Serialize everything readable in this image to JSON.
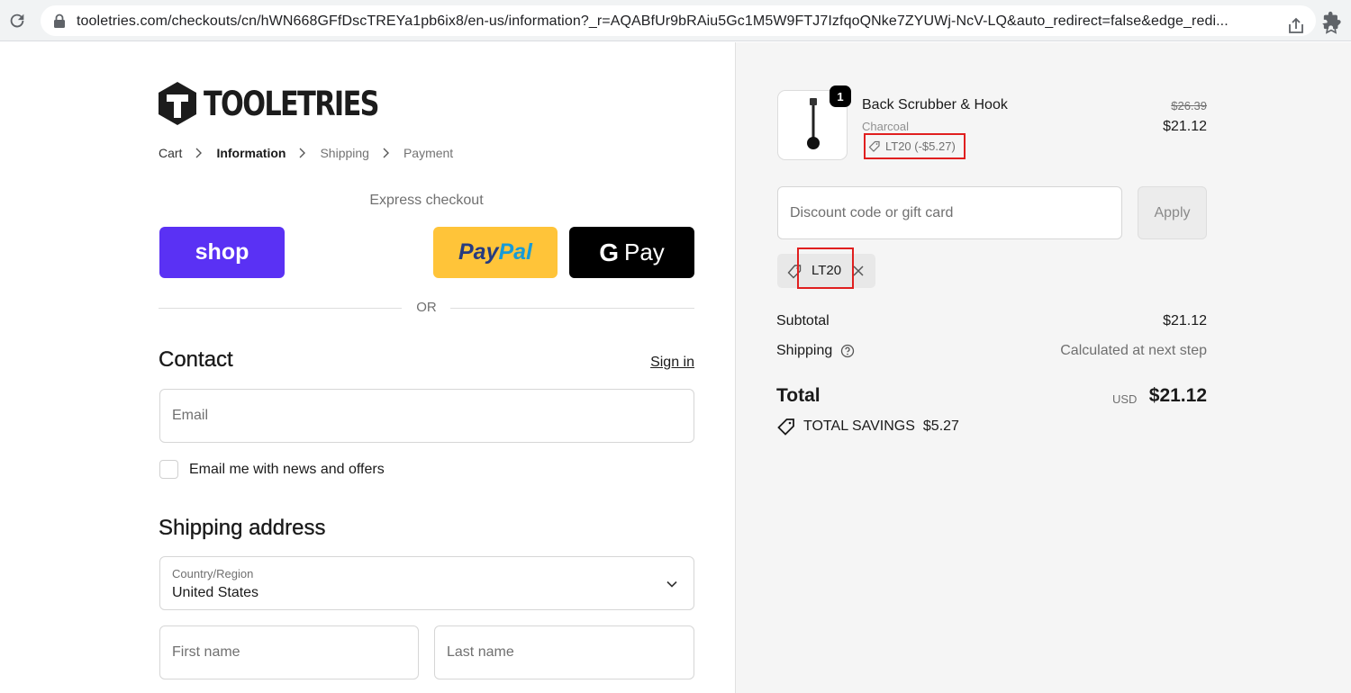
{
  "browser": {
    "url": "tooletries.com/checkouts/cn/hWN668GFfDscTREYa1pb6ix8/en-us/information?_r=AQABfUr9bRAiu5Gc1M5W9FTJ7IzfqoQNke7ZYUWj-NcV-LQ&auto_redirect=false&edge_redi..."
  },
  "brand": {
    "name": "TOOLETRIES"
  },
  "breadcrumb": {
    "cart": "Cart",
    "information": "Information",
    "shipping": "Shipping",
    "payment": "Payment"
  },
  "express": {
    "label": "Express checkout",
    "shop": "shop",
    "paypal_1": "Pay",
    "paypal_2": "Pal",
    "gpay_g": "G",
    "gpay": "Pay",
    "or": "OR"
  },
  "contact": {
    "heading": "Contact",
    "sign_in": "Sign in",
    "email_placeholder": "Email",
    "newsletter_label": "Email me with news and offers"
  },
  "shipping_address": {
    "heading": "Shipping address",
    "country_label": "Country/Region",
    "country_value": "United States",
    "first_name_placeholder": "First name",
    "last_name_placeholder": "Last name"
  },
  "order": {
    "quantity": "1",
    "product_name": "Back Scrubber & Hook",
    "variant": "Charcoal",
    "discount_tag": "LT20 (-$5.27)",
    "price_original": "$26.39",
    "price_current": "$21.12",
    "discount_placeholder": "Discount code or gift card",
    "apply_label": "Apply",
    "applied_code": "LT20",
    "subtotal_label": "Subtotal",
    "subtotal_value": "$21.12",
    "shipping_label": "Shipping",
    "shipping_value": "Calculated at next step",
    "total_label": "Total",
    "currency": "USD",
    "total_value": "$21.12",
    "savings_label": "TOTAL SAVINGS",
    "savings_value": "$5.27"
  },
  "colors": {
    "shop_purple": "#5a31f4",
    "paypal_yellow": "#ffc439",
    "highlight_red": "#e01f1f"
  }
}
